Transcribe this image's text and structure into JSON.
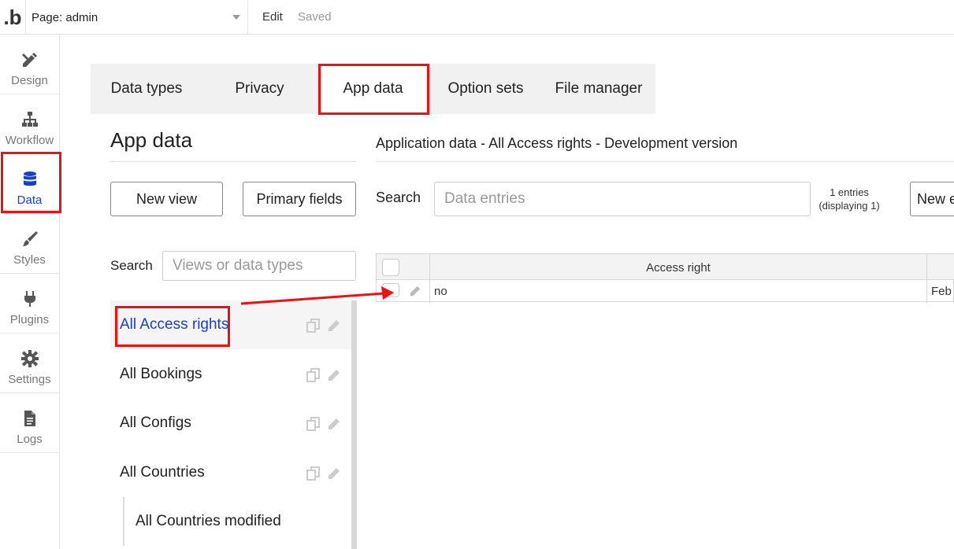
{
  "topbar": {
    "logo": ".b",
    "page_selector": "Page: admin",
    "edit_label": "Edit",
    "saved_label": "Saved"
  },
  "sidebar": {
    "items": [
      {
        "label": "Design",
        "icon": "pencil-ruler-icon"
      },
      {
        "label": "Workflow",
        "icon": "sitemap-icon"
      },
      {
        "label": "Data",
        "icon": "database-icon",
        "active": true
      },
      {
        "label": "Styles",
        "icon": "brush-icon"
      },
      {
        "label": "Plugins",
        "icon": "plug-icon"
      },
      {
        "label": "Settings",
        "icon": "gear-icon"
      },
      {
        "label": "Logs",
        "icon": "document-icon"
      }
    ]
  },
  "tabs": [
    {
      "label": "Data types"
    },
    {
      "label": "Privacy"
    },
    {
      "label": "App data",
      "active": true
    },
    {
      "label": "Option sets"
    },
    {
      "label": "File manager"
    }
  ],
  "left_panel": {
    "title": "App data",
    "new_view_button": "New view",
    "primary_fields_button": "Primary fields",
    "search_label": "Search",
    "search_placeholder": "Views or data types",
    "views": [
      {
        "label": "All Access rights",
        "active": true
      },
      {
        "label": "All Bookings"
      },
      {
        "label": "All Configs"
      },
      {
        "label": "All Countries"
      },
      {
        "label": "All Countries modified",
        "sub": true
      }
    ]
  },
  "right_panel": {
    "title": "Application data - All Access rights - Development version",
    "search_label": "Search",
    "search_placeholder": "Data entries",
    "entries_count": "1 entries",
    "entries_displaying": "(displaying 1)",
    "new_entry_button": "New e",
    "table": {
      "columns": [
        "Access right"
      ],
      "rows": [
        {
          "access_right": "no",
          "created": "Feb"
        }
      ]
    }
  },
  "colors": {
    "accent": "#1a3fc9",
    "annotation": "#e11111"
  }
}
